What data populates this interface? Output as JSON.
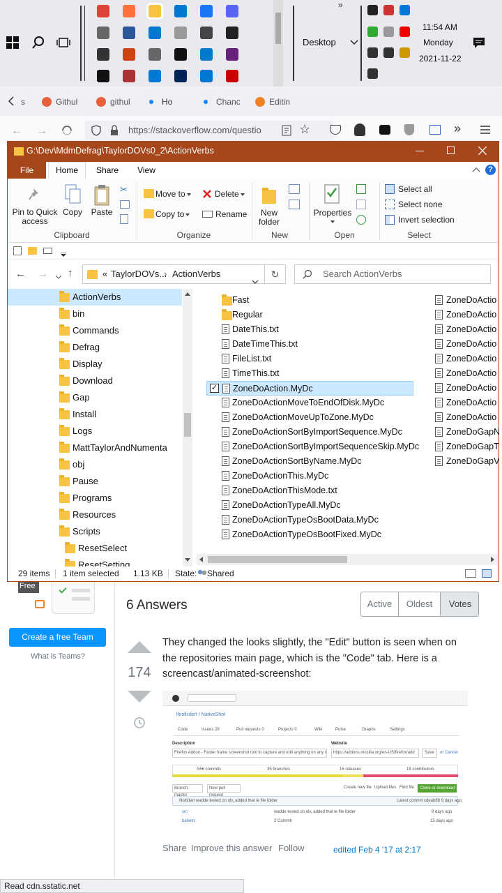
{
  "taskbar": {
    "desktop_label": "Desktop",
    "time": "11:54 AM",
    "day": "Monday",
    "date": "2021-11-22",
    "icons": [
      "chrome-icon",
      "firefox-icon",
      "file-explorer-icon",
      "outlook-icon",
      "messenger-icon",
      "discord-icon",
      "gimp-icon",
      "app-icon",
      "photos-icon",
      "speaker-icon",
      "tool-icon",
      "camera-icon",
      "printer-icon",
      "app-icon",
      "clock-icon",
      "cmd-icon",
      "vscode-icon",
      "visual-studio-icon",
      "cmd-icon",
      "app-icon",
      "paint-icon",
      "powershell-icon",
      "app-icon",
      "app-icon"
    ]
  },
  "browser": {
    "tabs": [
      {
        "label": "s"
      },
      {
        "label": "Githul"
      },
      {
        "label": "githul"
      },
      {
        "label": "Ho"
      },
      {
        "label": "Chanc"
      },
      {
        "label": "Editin"
      }
    ],
    "url": "https://stackoverflow.com/questio",
    "status_text": "Read cdn.sstatic.net"
  },
  "explorer": {
    "title": "G:\\Dev\\MdmDefrag\\TaylorDOVs0_2\\ActionVerbs",
    "ribbon_tabs": [
      "File",
      "Home",
      "Share",
      "View"
    ],
    "ribbon": {
      "pin": "Pin to Quick access",
      "copy": "Copy",
      "paste": "Paste",
      "clipboard_group": "Clipboard",
      "move_to": "Move to",
      "copy_to": "Copy to",
      "delete": "Delete",
      "rename": "Rename",
      "organize_group": "Organize",
      "new_folder": "New folder",
      "new_group": "New",
      "properties": "Properties",
      "open_group": "Open",
      "select_all": "Select all",
      "select_none": "Select none",
      "invert_selection": "Invert selection",
      "select_group": "Select"
    },
    "address": {
      "prefix": "«",
      "crumb1": "TaylorDOVs...",
      "crumb2": "ActionVerbs"
    },
    "search_placeholder": "Search ActionVerbs",
    "tree": [
      {
        "label": "ActionVerbs",
        "selected": true
      },
      {
        "label": "bin"
      },
      {
        "label": "Commands"
      },
      {
        "label": "Defrag"
      },
      {
        "label": "Display"
      },
      {
        "label": "Download"
      },
      {
        "label": "Gap"
      },
      {
        "label": "Install"
      },
      {
        "label": "Logs"
      },
      {
        "label": "MattTaylorAndNumenta"
      },
      {
        "label": "obj"
      },
      {
        "label": "Pause"
      },
      {
        "label": "Programs"
      },
      {
        "label": "Resources"
      },
      {
        "label": "Scripts"
      },
      {
        "label": "ResetSelect"
      },
      {
        "label": "ResetSetting"
      }
    ],
    "files_col1": [
      {
        "label": "Fast",
        "kind": "folder"
      },
      {
        "label": "Regular",
        "kind": "folder"
      },
      {
        "label": "DateThis.txt",
        "kind": "file"
      },
      {
        "label": "DateTimeThis.txt",
        "kind": "file"
      },
      {
        "label": "FileList.txt",
        "kind": "file"
      },
      {
        "label": "TimeThis.txt",
        "kind": "file"
      },
      {
        "label": "ZoneDoAction.MyDc",
        "kind": "file",
        "selected": true
      },
      {
        "label": "ZoneDoActionMoveToEndOfDisk.MyDc",
        "kind": "file"
      },
      {
        "label": "ZoneDoActionMoveUpToZone.MyDc",
        "kind": "file"
      },
      {
        "label": "ZoneDoActionSortByImportSequence.MyDc",
        "kind": "file"
      },
      {
        "label": "ZoneDoActionSortByImportSequenceSkip.MyDc",
        "kind": "file"
      },
      {
        "label": "ZoneDoActionSortByName.MyDc",
        "kind": "file"
      },
      {
        "label": "ZoneDoActionThis.MyDc",
        "kind": "file"
      },
      {
        "label": "ZoneDoActionThisMode.txt",
        "kind": "file"
      },
      {
        "label": "ZoneDoActionTypeAll.MyDc",
        "kind": "file"
      },
      {
        "label": "ZoneDoActionTypeOsBootData.MyDc",
        "kind": "file"
      },
      {
        "label": "ZoneDoActionTypeOsBootFixed.MyDc",
        "kind": "file"
      }
    ],
    "files_col2": [
      "ZoneDoActio",
      "ZoneDoActio",
      "ZoneDoActio",
      "ZoneDoActio",
      "ZoneDoActio",
      "ZoneDoActio",
      "ZoneDoActio",
      "ZoneDoActio",
      "ZoneDoActio",
      "ZoneDoGapN",
      "ZoneDoGapTh",
      "ZoneDoGapVa"
    ],
    "status": {
      "items": "29 items",
      "selected": "1 item selected",
      "size": "1.13 KB",
      "state_label": "State:",
      "state_value": "Shared"
    }
  },
  "stackoverflow": {
    "teams_free": "Free",
    "create_team": "Create a free Team",
    "what_is_teams": "What is Teams?",
    "answers_header": "6 Answers",
    "sort_tabs": [
      "Active",
      "Oldest",
      "Votes"
    ],
    "vote_count": "174",
    "answer_text": "They changed the looks slightly, the \"Edit\" button is seen when on the repositories main page, which is the \"Code\" tab. Here is a screencast/animated-screenshot:",
    "share": "Share",
    "improve": "Improve this answer",
    "follow": "Follow",
    "edited": "edited Feb 4 '17 at 2:17",
    "screenshot": {
      "repo": "lfoollcdert / NativeShot",
      "tabs": [
        "Code",
        "Issues 29",
        "Pull requests 0",
        "Projects 0",
        "Wiki",
        "Pulse",
        "Graphs",
        "Settings"
      ],
      "description_label": "Description",
      "website_label": "Website",
      "description": "Firefox Addon - Faster frame screenshot tool to capture and edit anything on any m",
      "website": "https://addons.mozilla.org/en-US/firefox/add",
      "save": "Save",
      "cancel": "or Cancel",
      "commits": "556 commits",
      "branches": "35 branches",
      "releases": "15 releases",
      "contributors": "18 contributors",
      "branch": "Branch: master",
      "new_pr": "New pull request",
      "create_file": "Create new file",
      "upload": "Upload files",
      "find": "Find file",
      "clone": "Clone or download",
      "commit_msg": "Noitidart wadde tested on olv, added that ie file folder",
      "latest": "Latest commit cdeab86  9 days ago",
      "rows": [
        {
          "name": "src",
          "msg": "wadde tested on olv, added that ie file folder",
          "age": "9 days ago"
        },
        {
          "name": "babelrc",
          "msg": "2 Commit",
          "age": "15 days ago"
        }
      ]
    }
  }
}
